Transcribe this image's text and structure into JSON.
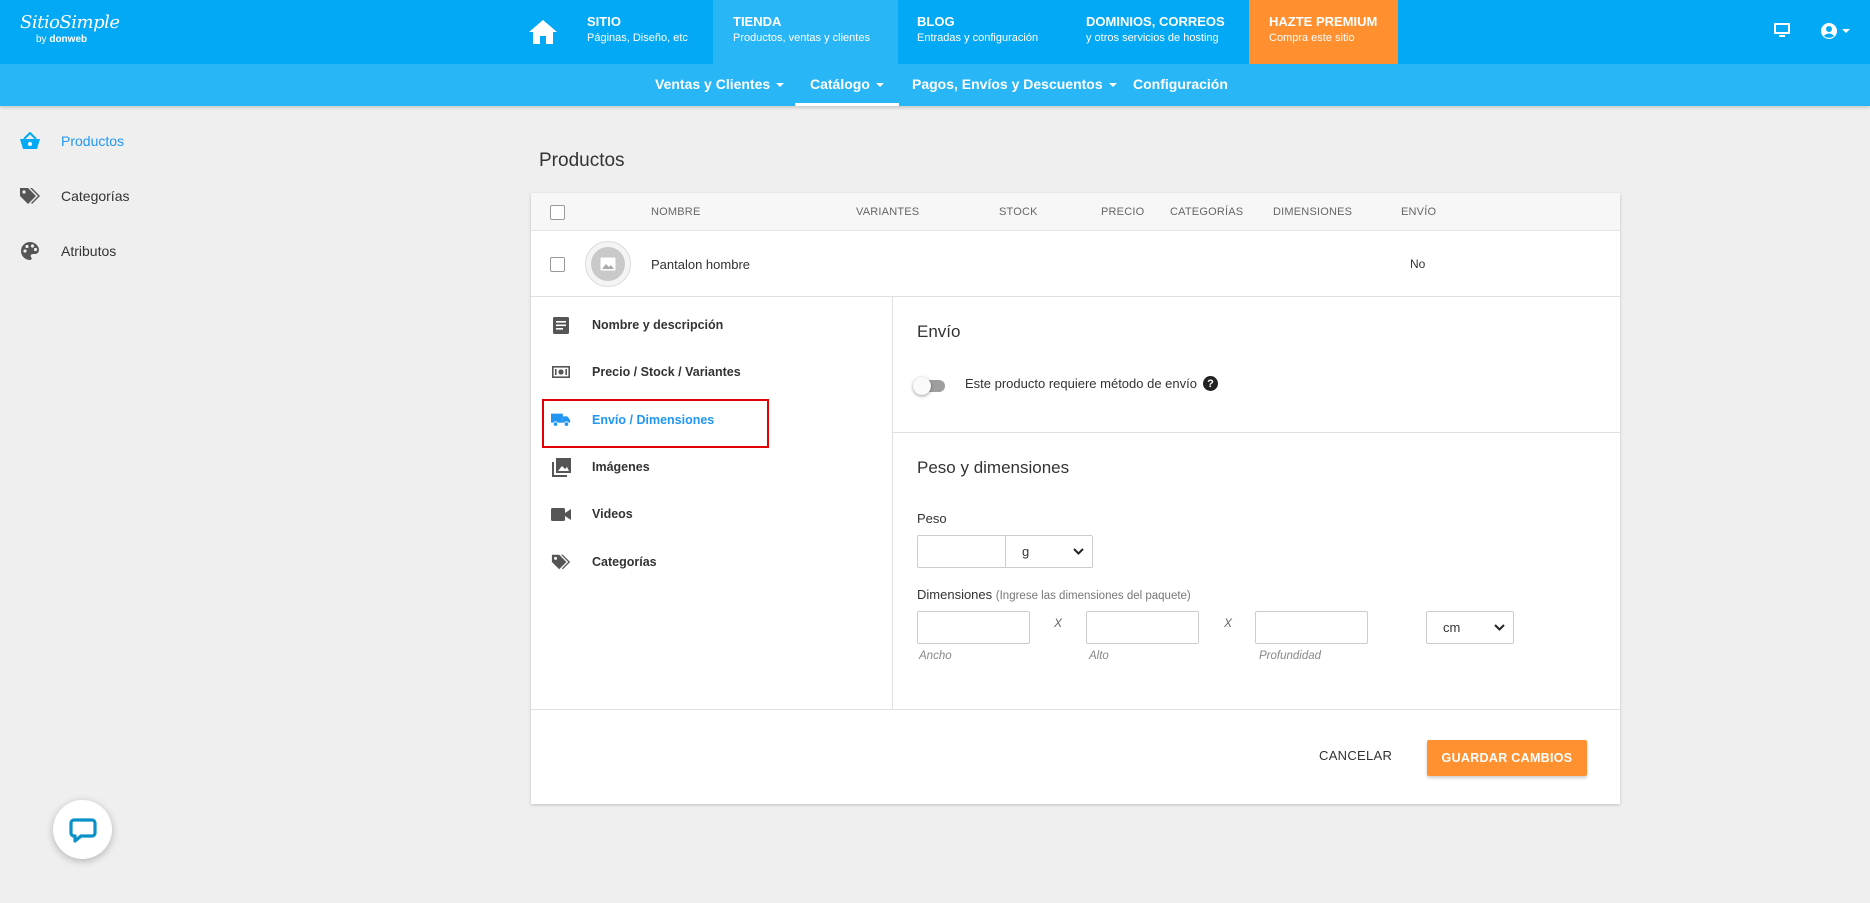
{
  "brand": {
    "name": "SitioSimple",
    "by": "by",
    "company": "donweb"
  },
  "topnav": [
    {
      "title": "SITIO",
      "subtitle": "Páginas, Diseño, etc"
    },
    {
      "title": "TIENDA",
      "subtitle": "Productos, ventas y clientes"
    },
    {
      "title": "BLOG",
      "subtitle": "Entradas y configuración"
    },
    {
      "title": "DOMINIOS, CORREOS",
      "subtitle": "y otros servicios de hosting"
    },
    {
      "title": "HAZTE PREMIUM",
      "subtitle": "Compra este sitio"
    }
  ],
  "subnav": [
    {
      "label": "Ventas y Clientes"
    },
    {
      "label": "Catálogo"
    },
    {
      "label": "Pagos, Envíos y Descuentos"
    },
    {
      "label": "Configuración"
    }
  ],
  "sidebar": [
    {
      "label": "Productos",
      "icon": "basket-icon"
    },
    {
      "label": "Categorías",
      "icon": "tags-icon"
    },
    {
      "label": "Atributos",
      "icon": "palette-icon"
    }
  ],
  "main": {
    "title": "Productos",
    "columns": [
      "NOMBRE",
      "VARIANTES",
      "STOCK",
      "PRECIO",
      "CATEGORÍAS",
      "DIMENSIONES",
      "ENVÍO"
    ],
    "product": {
      "name": "Pantalon hombre",
      "envio": "No"
    }
  },
  "detail_menu": [
    {
      "label": "Nombre y descripción",
      "icon": "document-icon"
    },
    {
      "label": "Precio / Stock / Variantes",
      "icon": "money-icon"
    },
    {
      "label": "Envío / Dimensiones",
      "icon": "truck-icon"
    },
    {
      "label": "Imágenes",
      "icon": "images-icon"
    },
    {
      "label": "Videos",
      "icon": "video-icon"
    },
    {
      "label": "Categorías",
      "icon": "tags-icon"
    }
  ],
  "envio": {
    "title": "Envío",
    "toggle_label": "Este producto requiere método de envío",
    "help": "?"
  },
  "peso": {
    "title": "Peso y dimensiones",
    "peso_label": "Peso",
    "peso_unit": "g",
    "dim_label": "Dimensiones",
    "dim_hint": "(Ingrese las dimensiones del paquete)",
    "x": "X",
    "ancho": "Ancho",
    "alto": "Alto",
    "profundidad": "Profundidad",
    "dim_unit": "cm"
  },
  "footer": {
    "cancel": "CANCELAR",
    "save": "GUARDAR CAMBIOS"
  },
  "colors": {
    "primary": "#03a9f4",
    "secondary": "#29b6f6",
    "premium": "#ff8f2f",
    "save": "#ff9131",
    "active_text": "#2196f3",
    "highlight": "#e30000"
  }
}
